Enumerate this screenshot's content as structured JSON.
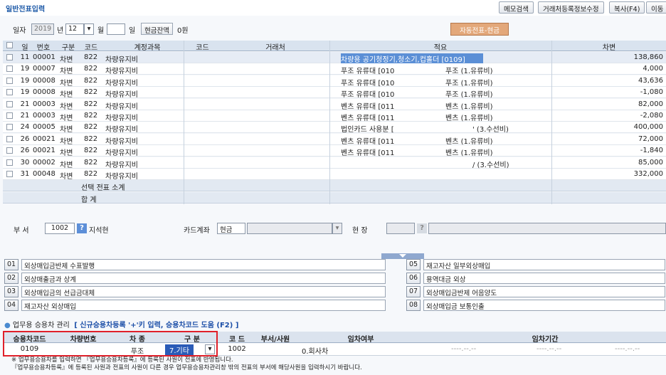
{
  "window": {
    "title": "일반전표입력"
  },
  "toolbar": {
    "buttons": [
      "메모검색",
      "거래처등록정보수정",
      "복사(F4)",
      "이동"
    ]
  },
  "datebar": {
    "date_label": "일자",
    "year": "2019",
    "year_unit": "년",
    "month": "12",
    "month_unit": "월",
    "day": "",
    "day_unit": "일",
    "cash_balance_btn": "현금잔액",
    "cash_balance_value": "0원",
    "auto_btn": "자동전표-현금"
  },
  "grid": {
    "headers": [
      "일",
      "번호",
      "구분",
      "코드",
      "계정과목",
      "코드",
      "거래처",
      "적요",
      "차변"
    ],
    "rows": [
      {
        "day": "11",
        "no": "00001",
        "type": "차변",
        "code": "822",
        "account": "차량유지비",
        "memo": "차량용 공기청정기,청소기,컵홀더 [0109]",
        "memo2": "",
        "amount": "138,860"
      },
      {
        "day": "19",
        "no": "00007",
        "type": "차변",
        "code": "822",
        "account": "차량유지비",
        "memo": "푸조 유류대 [010",
        "memo2": "푸조 (1.유류비)",
        "amount": "4,000"
      },
      {
        "day": "19",
        "no": "00008",
        "type": "차변",
        "code": "822",
        "account": "차량유지비",
        "memo": "푸조 유류대 [010",
        "memo2": "푸조 (1.유류비)",
        "amount": "43,636"
      },
      {
        "day": "19",
        "no": "00008",
        "type": "차변",
        "code": "822",
        "account": "차량유지비",
        "memo": "푸조 유류대 [010",
        "memo2": "푸조 (1.유류비)",
        "amount": "-1,080"
      },
      {
        "day": "21",
        "no": "00003",
        "type": "차변",
        "code": "822",
        "account": "차량유지비",
        "memo": "벤츠 유류대 [011",
        "memo2": "벤츠 (1.유류비)",
        "amount": "82,000"
      },
      {
        "day": "21",
        "no": "00003",
        "type": "차변",
        "code": "822",
        "account": "차량유지비",
        "memo": "벤츠 유류대 [011",
        "memo2": "벤츠 (1.유류비)",
        "amount": "-2,080"
      },
      {
        "day": "24",
        "no": "00005",
        "type": "차변",
        "code": "822",
        "account": "차량유지비",
        "memo": "법인카드 사용분 [",
        "memo2": "' (3.수선비)",
        "amount": "400,000"
      },
      {
        "day": "26",
        "no": "00021",
        "type": "차변",
        "code": "822",
        "account": "차량유지비",
        "memo": "벤츠 유류대 [011",
        "memo2": "벤츠 (1.유류비)",
        "amount": "72,000"
      },
      {
        "day": "26",
        "no": "00021",
        "type": "차변",
        "code": "822",
        "account": "차량유지비",
        "memo": "벤츠 유류대 [011",
        "memo2": "벤츠 (1.유류비)",
        "amount": "-1,840"
      },
      {
        "day": "30",
        "no": "00002",
        "type": "차변",
        "code": "822",
        "account": "차량유지비",
        "memo": "",
        "memo2": "/ (3.수선비)",
        "amount": "85,000"
      },
      {
        "day": "31",
        "no": "00048",
        "type": "차변",
        "code": "822",
        "account": "차량유지비",
        "memo": "",
        "memo2": "",
        "amount": "332,000"
      }
    ],
    "subtotal_label": "선택 전표 소계",
    "total_label": "합          계"
  },
  "dept": {
    "dept_label": "부     서",
    "dept_code": "1002",
    "dept_name": "지석현",
    "card_label": "카드계좌",
    "card_value": "현금",
    "site_label": "현     장"
  },
  "options": [
    {
      "num": "01",
      "text": "외상매입금반제 수표발행"
    },
    {
      "num": "02",
      "text": "외상매출금과 상계"
    },
    {
      "num": "03",
      "text": "외상매입금의 선급금대체"
    },
    {
      "num": "04",
      "text": "재고자산 외상매입"
    },
    {
      "num": "05",
      "text": "재고자산 일부외상매입"
    },
    {
      "num": "06",
      "text": "용역대금 외상"
    },
    {
      "num": "07",
      "text": "외상매입금반제 어음양도"
    },
    {
      "num": "08",
      "text": "외상매입금 보통인출"
    }
  ],
  "car_section": {
    "title": "업무용 승용차 관리",
    "hint": "[ 신규승용차등록 '+'키 입력, 승용차코드 도움 (F2) ]",
    "headers": [
      "승용차코드",
      "차량번호",
      "차 종",
      "구 분",
      "코 드",
      "부서/사원",
      "임차여부",
      "임차기간"
    ],
    "row": {
      "car_code": "0109",
      "car_no": "",
      "car_type": "푸조",
      "category": "7.기타",
      "code": "1002",
      "dept": "",
      "lease": "0.회사차",
      "period1": "----.--.--",
      "period2": "----.--.--",
      "period3": "----.--.--"
    }
  },
  "notes": [
    "※ 업무용승용차를 입력하면 『업무용승용차등록』에 등록된 사원이 전표에 반영됩니다.",
    "『업무용승용차등록』에 등록된 사원과 전표의 사원이 다른 경우 업무용승용차관리창 밖의 전표의 부서에 해당사원을 입력하시기 바랍니다."
  ]
}
